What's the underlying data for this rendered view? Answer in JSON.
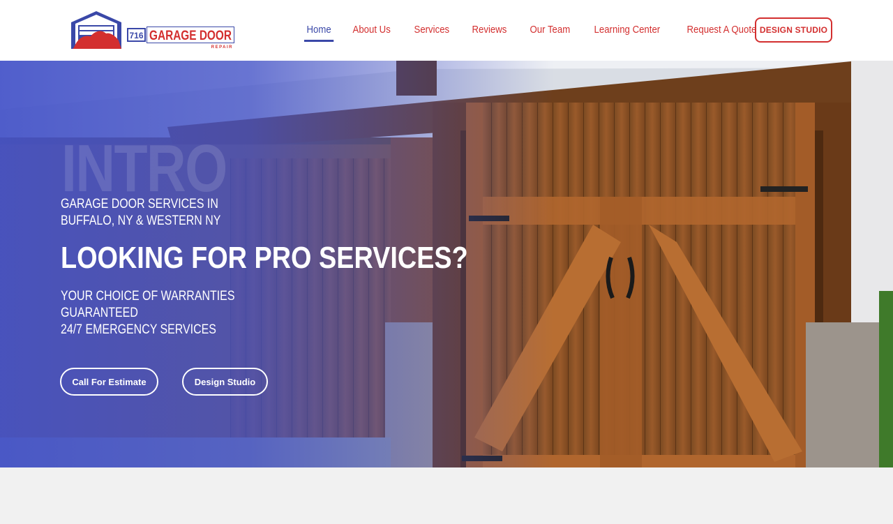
{
  "header": {
    "logo": {
      "number": "716",
      "brand": "GARAGE DOOR",
      "sub": "REPAIR"
    },
    "nav": [
      {
        "label": "Home",
        "active": true
      },
      {
        "label": "About Us",
        "active": false
      },
      {
        "label": "Services",
        "active": false
      },
      {
        "label": "Reviews",
        "active": false
      },
      {
        "label": "Our Team",
        "active": false
      },
      {
        "label": "Learning Center",
        "active": false
      },
      {
        "label": "Request A Quote",
        "active": false
      }
    ],
    "cta": "DESIGN STUDIO"
  },
  "hero": {
    "watermark": "INTRO",
    "kicker_line1": "GARAGE DOOR SERVICES IN",
    "kicker_line2": "BUFFALO, NY & WESTERN NY",
    "headline": "LOOKING FOR PRO SERVICES?",
    "sub_line1": "YOUR CHOICE OF WARRANTIES GUARANTEED",
    "sub_line2": "24/7 EMERGENCY SERVICES",
    "buttons": {
      "estimate": "Call For Estimate",
      "design": "Design Studio"
    }
  },
  "colors": {
    "brand_red": "#d32f2f",
    "brand_blue": "#3a48a8",
    "overlay": "#4352c8"
  }
}
